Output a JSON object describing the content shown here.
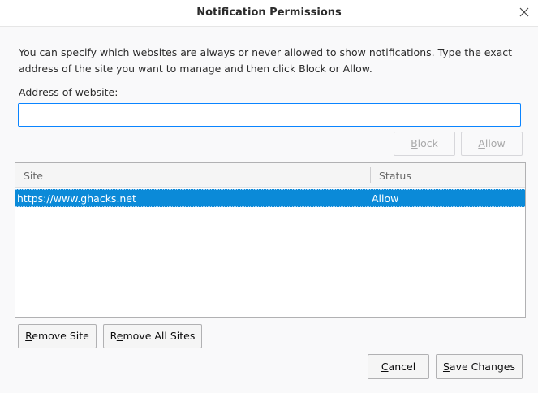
{
  "dialog": {
    "title": "Notification Permissions",
    "close_icon": "close-icon"
  },
  "description": "You can specify which websites are always or never allowed to show notifications. Type the exact address of the site you want to manage and then click Block or Allow.",
  "address": {
    "label_prefix": "A",
    "label_rest": "ddress of website:",
    "value": "",
    "placeholder": ""
  },
  "actions": {
    "block_prefix": "B",
    "block_rest": "lock",
    "allow_prefix": "A",
    "allow_rest": "llow"
  },
  "table": {
    "columns": [
      "Site",
      "Status"
    ],
    "rows": [
      {
        "site": "https://www.ghacks.net",
        "status": "Allow",
        "selected": true
      }
    ]
  },
  "list_buttons": {
    "remove_site_prefix": "R",
    "remove_site_rest": "emove Site",
    "remove_all_prefix": "R",
    "remove_all_mid": "e",
    "remove_all_rest": "move All Sites"
  },
  "footer": {
    "cancel_prefix": "C",
    "cancel_rest": "ancel",
    "save_prefix": "S",
    "save_rest": "ave Changes"
  },
  "colors": {
    "accent": "#0a84ff",
    "selection": "#0b8ad8"
  }
}
